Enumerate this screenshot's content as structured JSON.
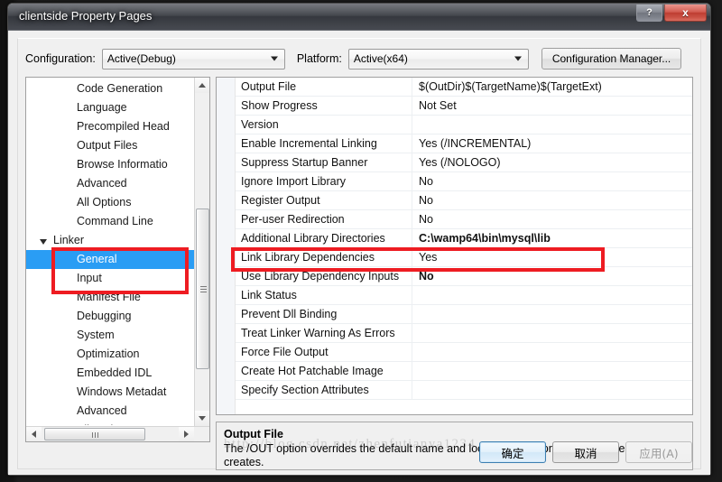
{
  "window": {
    "title": "clientside Property Pages",
    "help_button": "?",
    "close_button": "x"
  },
  "toolbar": {
    "configuration_label": "Configuration:",
    "configuration_value": "Active(Debug)",
    "platform_label": "Platform:",
    "platform_value": "Active(x64)",
    "configuration_manager_label": "Configuration Manager..."
  },
  "tree": {
    "items": [
      {
        "label": "Code Generation",
        "type": "leaf",
        "selected": false
      },
      {
        "label": "Language",
        "type": "leaf",
        "selected": false
      },
      {
        "label": "Precompiled Head",
        "type": "leaf",
        "selected": false
      },
      {
        "label": "Output Files",
        "type": "leaf",
        "selected": false
      },
      {
        "label": "Browse Informatio",
        "type": "leaf",
        "selected": false
      },
      {
        "label": "Advanced",
        "type": "leaf",
        "selected": false
      },
      {
        "label": "All Options",
        "type": "leaf",
        "selected": false
      },
      {
        "label": "Command Line",
        "type": "leaf",
        "selected": false
      },
      {
        "label": "Linker",
        "type": "group",
        "selected": false
      },
      {
        "label": "General",
        "type": "leaf",
        "selected": true
      },
      {
        "label": "Input",
        "type": "leaf",
        "selected": false
      },
      {
        "label": "Manifest File",
        "type": "leaf",
        "selected": false
      },
      {
        "label": "Debugging",
        "type": "leaf",
        "selected": false
      },
      {
        "label": "System",
        "type": "leaf",
        "selected": false
      },
      {
        "label": "Optimization",
        "type": "leaf",
        "selected": false
      },
      {
        "label": "Embedded IDL",
        "type": "leaf",
        "selected": false
      },
      {
        "label": "Windows Metadat",
        "type": "leaf",
        "selected": false
      },
      {
        "label": "Advanced",
        "type": "leaf",
        "selected": false
      },
      {
        "label": "All Options",
        "type": "leaf",
        "selected": false
      }
    ]
  },
  "property_grid": {
    "rows": [
      {
        "name": "Output File",
        "value": "$(OutDir)$(TargetName)$(TargetExt)",
        "bold": false
      },
      {
        "name": "Show Progress",
        "value": "Not Set",
        "bold": false
      },
      {
        "name": "Version",
        "value": "",
        "bold": false
      },
      {
        "name": "Enable Incremental Linking",
        "value": "Yes (/INCREMENTAL)",
        "bold": false
      },
      {
        "name": "Suppress Startup Banner",
        "value": "Yes (/NOLOGO)",
        "bold": false
      },
      {
        "name": "Ignore Import Library",
        "value": "No",
        "bold": false
      },
      {
        "name": "Register Output",
        "value": "No",
        "bold": false
      },
      {
        "name": "Per-user Redirection",
        "value": "No",
        "bold": false
      },
      {
        "name": "Additional Library Directories",
        "value": "C:\\wamp64\\bin\\mysql\\lib",
        "bold": true
      },
      {
        "name": "Link Library Dependencies",
        "value": "Yes",
        "bold": false
      },
      {
        "name": "Use Library Dependency Inputs",
        "value": "No",
        "bold": true
      },
      {
        "name": "Link Status",
        "value": "",
        "bold": false
      },
      {
        "name": "Prevent Dll Binding",
        "value": "",
        "bold": false
      },
      {
        "name": "Treat Linker Warning As Errors",
        "value": "",
        "bold": false
      },
      {
        "name": "Force File Output",
        "value": "",
        "bold": false
      },
      {
        "name": "Create Hot Patchable Image",
        "value": "",
        "bold": false
      },
      {
        "name": "Specify Section Attributes",
        "value": "",
        "bold": false
      }
    ]
  },
  "description": {
    "title": "Output File",
    "text": "The /OUT option overrides the default name and location of the program that the linker creates."
  },
  "buttons": {
    "ok": "确定",
    "cancel": "取消",
    "apply": "应用(A)"
  },
  "watermark": {
    "text": "http://blog.csdn.net/zhenfutianya1234"
  },
  "colors": {
    "selection_blue": "#2a9df4",
    "annotation_red": "#ee1c22",
    "window_chrome": "#3f4248",
    "close_red": "#cf4f43"
  }
}
